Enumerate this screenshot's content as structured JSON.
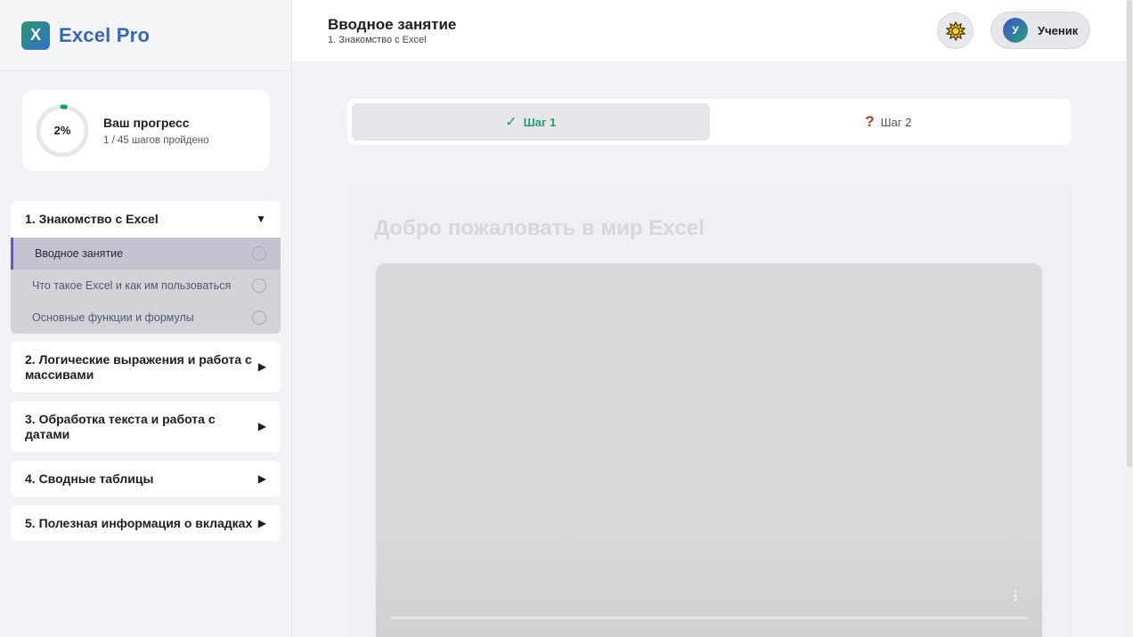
{
  "brand": {
    "logo_letter": "X",
    "name": "Excel Pro",
    "logo_gradient": [
      "#2c9a67",
      "#2f6fcf"
    ]
  },
  "progress": {
    "percent_label": "2%",
    "value": 0.02,
    "title": "Ваш прогресс",
    "subtitle": "1 / 45 шагов пройдено",
    "accent_color": "#1f9d67"
  },
  "modules": [
    {
      "title": "1. Знакомство с Excel",
      "expanded": true,
      "arrow": "▼",
      "lessons": [
        {
          "title": "Вводное занятие",
          "active": true
        },
        {
          "title": "Что такое Excel и как им пользоваться",
          "active": false
        },
        {
          "title": "Основные функции и формулы",
          "active": false
        }
      ]
    },
    {
      "title": "2. Логические выражения и работа с массивами",
      "expanded": false,
      "arrow": "▶"
    },
    {
      "title": "3. Обработка текста и работа с датами",
      "expanded": false,
      "arrow": "▶"
    },
    {
      "title": "4. Сводные таблицы",
      "expanded": false,
      "arrow": "▶"
    },
    {
      "title": "5. Полезная информация о вкладках",
      "expanded": false,
      "arrow": "▶"
    }
  ],
  "header": {
    "title": "Вводное занятие",
    "subtitle": "1. Знакомство с Excel",
    "theme_icon": "sun-icon",
    "user": {
      "initial": "У",
      "name": "Ученик"
    }
  },
  "steps": [
    {
      "label": "Шаг 1",
      "status": "done",
      "glyph": "✓",
      "active": true
    },
    {
      "label": "Шаг 2",
      "status": "unknown",
      "glyph": "?",
      "active": false
    }
  ],
  "lesson": {
    "heading": "Добро пожаловать в мир Excel",
    "video_menu_glyph": "⋮"
  },
  "colors": {
    "active_lesson_border": "#6a58c8",
    "step_done": "#1f9d67",
    "step_question": "#c0322e",
    "brand_text": "#3a66b8"
  }
}
